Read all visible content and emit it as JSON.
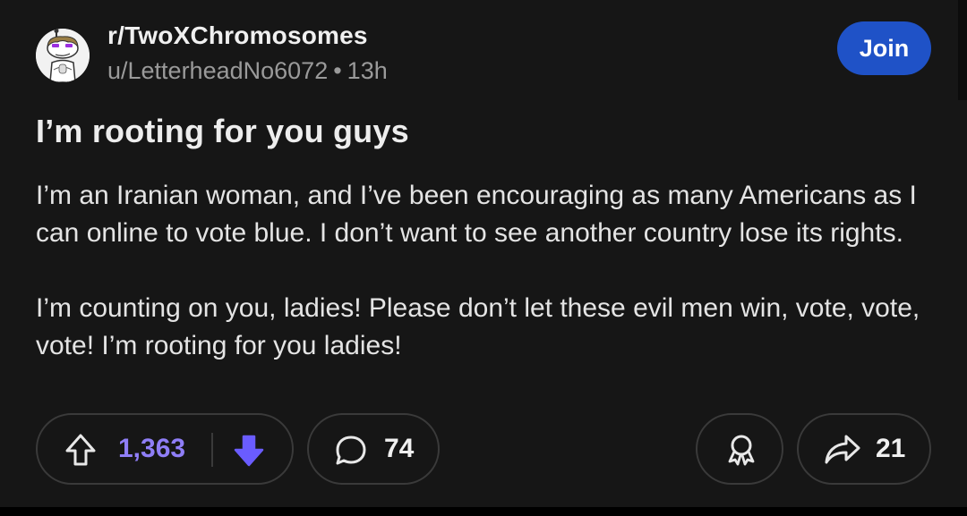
{
  "post": {
    "subreddit": "r/TwoXChromosomes",
    "author": "u/LetterheadNo6072",
    "separator": "•",
    "age": "13h",
    "join_label": "Join",
    "title": "I’m rooting for you guys",
    "paragraphs": [
      "I’m an Iranian woman, and I’ve been encouraging as many Americans as I can online to vote blue. I don’t want to see another country lose its rights.",
      "I’m counting on you, ladies! Please don’t let these evil men win, vote, vote, vote! I’m rooting for you ladies!"
    ]
  },
  "actions": {
    "upvotes": "1,363",
    "comments": "74",
    "shares": "21",
    "icons": {
      "upvote": "upvote-arrow-icon",
      "downvote": "downvote-arrow-icon",
      "comment": "comment-bubble-icon",
      "award": "award-ribbon-icon",
      "share": "share-arrow-icon"
    }
  },
  "colors": {
    "background": "#161616",
    "join_button": "#1f52c7",
    "vote_accent": "#8f7ef7",
    "downvote_active": "#6a5cff",
    "muted_text": "#9a9a9a"
  }
}
